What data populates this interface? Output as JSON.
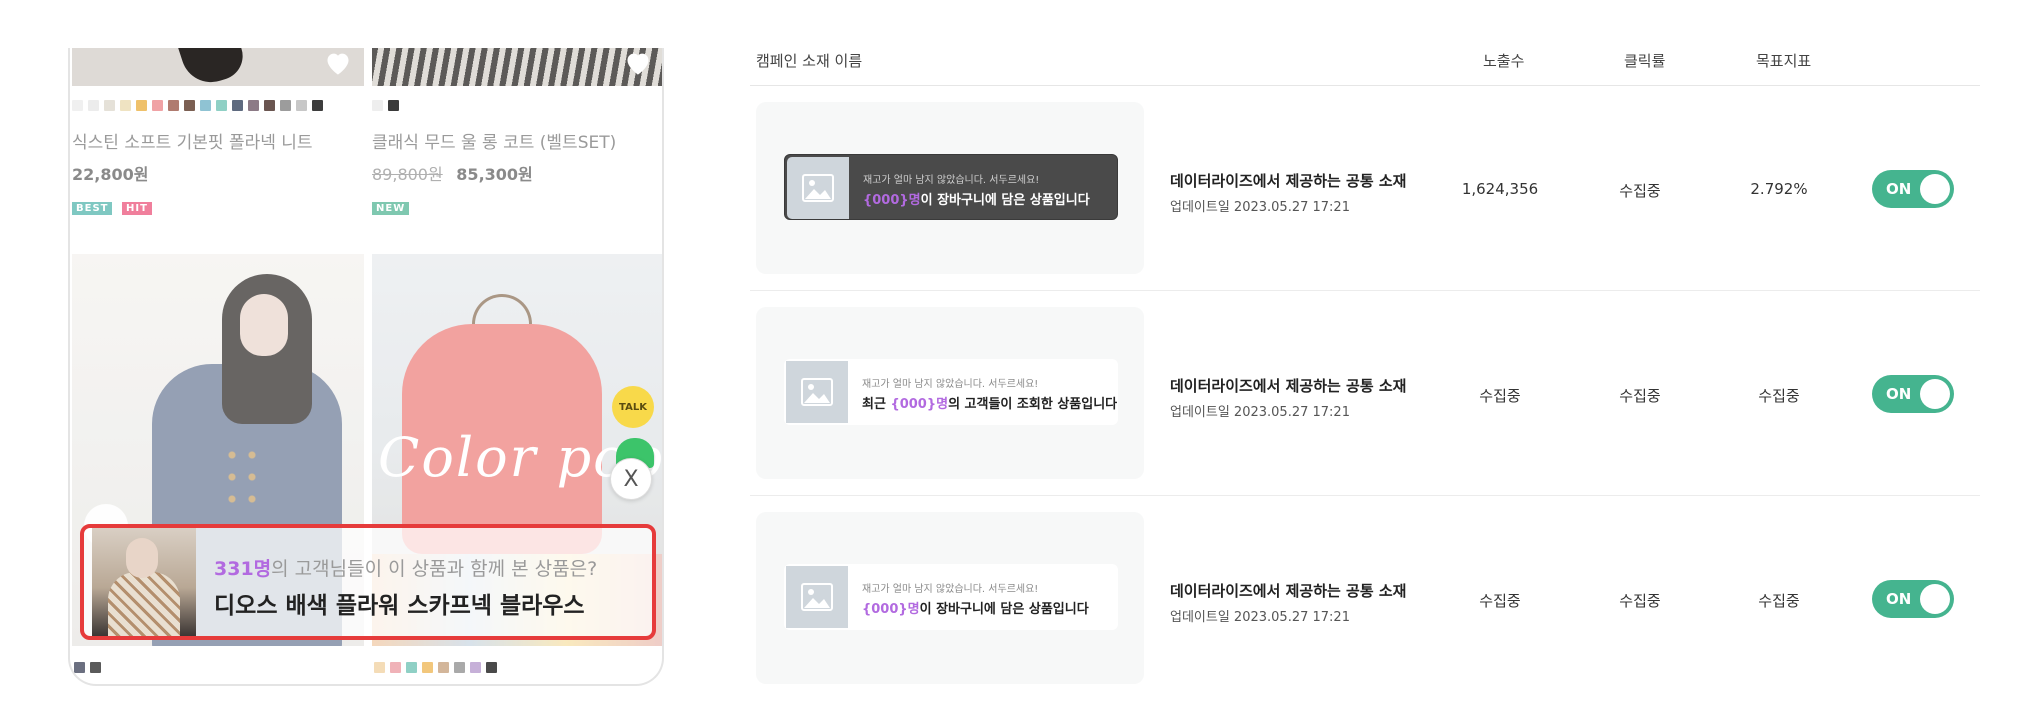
{
  "shop_preview": {
    "products": [
      {
        "name": "식스틴 소프트 기본핏 폴라넥 니트",
        "price": "22,800원",
        "old_price": "",
        "badges": [
          {
            "label": "BEST",
            "color": "#7fc8c2"
          },
          {
            "label": "HIT",
            "color": "#f07f9c"
          }
        ],
        "swatches": [
          "#f0f0f0",
          "#ececec",
          "#e5e1d8",
          "#efe3c2",
          "#efc16a",
          "#f0a2a5",
          "#b07b6f",
          "#7b5f52",
          "#8fc3d3",
          "#8fd0c5",
          "#5e6a7f",
          "#8c7a86",
          "#6a5550",
          "#9c9c9c",
          "#c7c7c7",
          "#3d3d3d"
        ]
      },
      {
        "name": "클래식 무드 울 롱 코트 (벨트SET)",
        "price": "85,300원",
        "old_price": "89,800원",
        "badges": [
          {
            "label": "NEW",
            "color": "#7fc8b0"
          }
        ],
        "swatches": [
          "#eeeeee",
          "#3a3a3a"
        ]
      }
    ],
    "bottom_swatches_left": [
      "#6b6f80",
      "#5a5a5a"
    ],
    "bottom_swatches_right": [
      "#f4dcb7",
      "#f0b2b8",
      "#8fd0c5",
      "#f2c77c",
      "#d3b69a",
      "#a9a9a9",
      "#c6b0d8",
      "#4a4a4a"
    ],
    "image_text": "Color pop",
    "talk_label": "TALK",
    "close_label": "X",
    "popup": {
      "count_highlight": "331명",
      "line1_rest": "의 고객님들이 이 상품과 함께 본 상품은?",
      "line2": "디오스 배색 플라워 스카프넥 블라우스"
    }
  },
  "campaign_table": {
    "headers": {
      "name": "캠페인 소재 이름",
      "impressions": "노출수",
      "ctr": "클릭률",
      "goal": "목표지표"
    },
    "rows": [
      {
        "banner_style": "dark",
        "banner_sub": "재고가 얼마 남지 않았습니다. 서두르세요!",
        "banner_prefix": "",
        "banner_placeholder": "{000}명",
        "banner_suffix": "이 장바구니에 담은 상품입니다",
        "title": "데이터라이즈에서 제공하는 공통 소재",
        "updated": "업데이트일 2023.05.27 17:21",
        "impressions": "1,624,356",
        "ctr": "수집중",
        "goal": "2.792%",
        "toggle": "ON"
      },
      {
        "banner_style": "light",
        "banner_sub": "재고가 얼마 남지 않았습니다. 서두르세요!",
        "banner_prefix": "최근 ",
        "banner_placeholder": "{000}명",
        "banner_suffix": "의 고객들이 조회한 상품입니다",
        "title": "데이터라이즈에서 제공하는 공통 소재",
        "updated": "업데이트일 2023.05.27 17:21",
        "impressions": "수집중",
        "ctr": "수집중",
        "goal": "수집중",
        "toggle": "ON"
      },
      {
        "banner_style": "light",
        "banner_sub": "재고가 얼마 남지 않았습니다. 서두르세요!",
        "banner_prefix": "",
        "banner_placeholder": "{000}명",
        "banner_suffix": "이 장바구니에 담은 상품입니다",
        "title": "데이터라이즈에서 제공하는 공통 소재",
        "updated": "업데이트일 2023.05.27 17:21",
        "impressions": "수집중",
        "ctr": "수집중",
        "goal": "수집중",
        "toggle": "ON"
      }
    ]
  },
  "colors": {
    "accent_purple": "#b26ae0",
    "toggle_green": "#45b48f",
    "popup_border_red": "#e63b3b"
  }
}
